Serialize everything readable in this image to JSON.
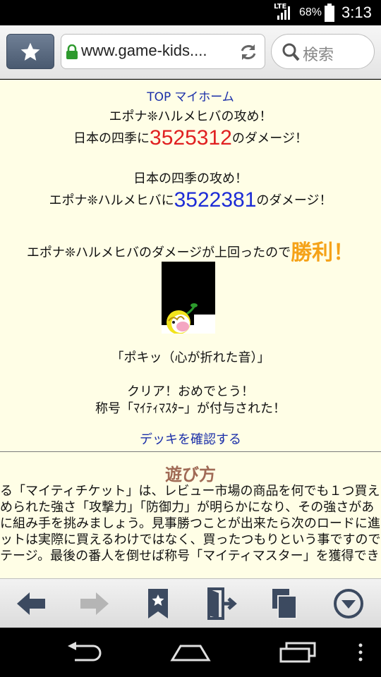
{
  "status_bar": {
    "network": "LTE",
    "battery_percent": "68%",
    "time": "3:13"
  },
  "browser": {
    "url": "www.game-kids....",
    "search_placeholder": "検索"
  },
  "page": {
    "nav": {
      "top_link": "TOP",
      "myhome_link": "マイホーム"
    },
    "attack1": {
      "line1": "エポナ❊ハルメヒバの攻め！",
      "prefix": "日本の四季に",
      "damage": "3525312",
      "suffix": "のダメージ！"
    },
    "attack2": {
      "line1": "日本の四季の攻め！",
      "prefix": "エポナ❊ハルメヒバに",
      "damage": "3522381",
      "suffix": "のダメージ！"
    },
    "result": {
      "prefix": "エポナ❊ハルメヒバのダメージが上回ったので",
      "victory": "勝利！"
    },
    "quote": "「ポキッ（心が折れた音）」",
    "clear_line": "クリア！おめでとう！",
    "title_line": "称号「ﾏｲﾃｨﾏｽﾀｰ」が付与された！",
    "deck_link": "デッキを確認する",
    "howto_title": "遊び方",
    "rules": [
      "る「マイティチケット」は、レビュー市場の商品を何でも１つ買え",
      "められた強さ「攻撃力」「防御力」が明らかになり、その強さがあ",
      "に組み手を挑みましょう。見事勝つことが出来たら次のロードに進",
      "ットは実際に買えるわけではなく、買ったつもりという事ですので注",
      "テージ。最後の番人を倒せば称号「マイティマスター」を獲得でき"
    ]
  },
  "colors": {
    "page_background": "#fffee6",
    "link": "#1a2ea8",
    "damage_red": "#e02020",
    "damage_blue": "#1c2bd6",
    "victory_orange": "#f5a218",
    "howto_title": "#a06a55"
  }
}
